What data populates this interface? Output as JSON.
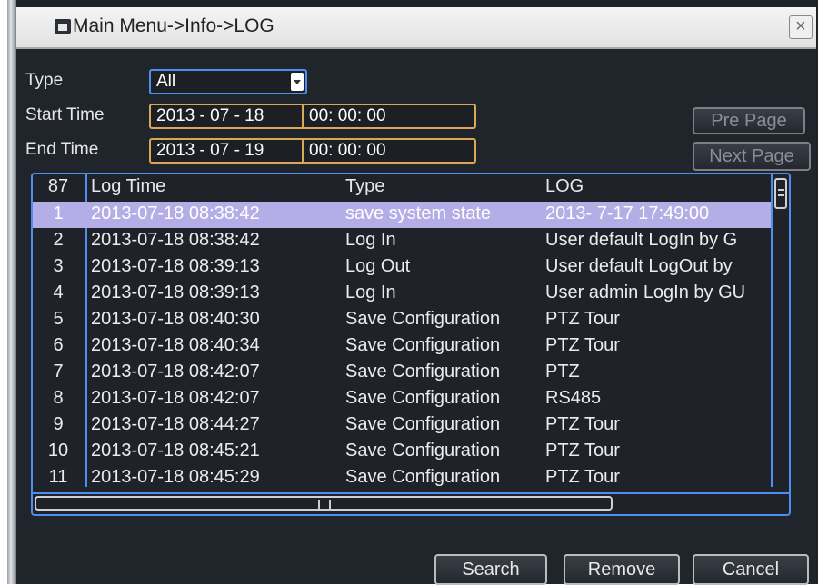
{
  "window": {
    "title": "Main Menu->Info->LOG",
    "close_label": "×"
  },
  "filters": {
    "type_label": "Type",
    "type_value": "All",
    "start_label": "Start Time",
    "start_date": "2013 - 07 - 18",
    "start_time": "00: 00: 00",
    "end_label": "End Time",
    "end_date": "2013 - 07 - 19",
    "end_time": "00: 00: 00"
  },
  "paging": {
    "pre_label": "Pre Page",
    "next_label": "Next Page"
  },
  "table": {
    "count": "87",
    "columns": [
      "Log Time",
      "Type",
      "LOG"
    ],
    "rows": [
      {
        "num": "1",
        "time": "2013-07-18 08:38:42",
        "type": "save system state",
        "log": "2013- 7-17 17:49:00"
      },
      {
        "num": "2",
        "time": "2013-07-18 08:38:42",
        "type": "Log In",
        "log": "User default LogIn by G"
      },
      {
        "num": "3",
        "time": "2013-07-18 08:39:13",
        "type": "Log Out",
        "log": "User default LogOut by"
      },
      {
        "num": "4",
        "time": "2013-07-18 08:39:13",
        "type": "Log In",
        "log": "User admin LogIn by GU"
      },
      {
        "num": "5",
        "time": "2013-07-18 08:40:30",
        "type": "Save Configuration",
        "log": "PTZ Tour"
      },
      {
        "num": "6",
        "time": "2013-07-18 08:40:34",
        "type": "Save Configuration",
        "log": "PTZ Tour"
      },
      {
        "num": "7",
        "time": "2013-07-18 08:42:07",
        "type": "Save Configuration",
        "log": "PTZ"
      },
      {
        "num": "8",
        "time": "2013-07-18 08:42:07",
        "type": "Save Configuration",
        "log": "RS485"
      },
      {
        "num": "9",
        "time": "2013-07-18 08:44:27",
        "type": "Save Configuration",
        "log": "PTZ Tour"
      },
      {
        "num": "10",
        "time": "2013-07-18 08:45:21",
        "type": "Save Configuration",
        "log": "PTZ Tour"
      },
      {
        "num": "11",
        "time": "2013-07-18 08:45:29",
        "type": "Save Configuration",
        "log": "PTZ Tour"
      }
    ],
    "selected_row": 0
  },
  "actions": {
    "search_label": "Search",
    "remove_label": "Remove",
    "cancel_label": "Cancel"
  },
  "colors": {
    "accent_blue": "#4d8ff0",
    "field_border": "#d9a65a",
    "selection": "#b5aee6",
    "panel_bg": "#20242b"
  }
}
